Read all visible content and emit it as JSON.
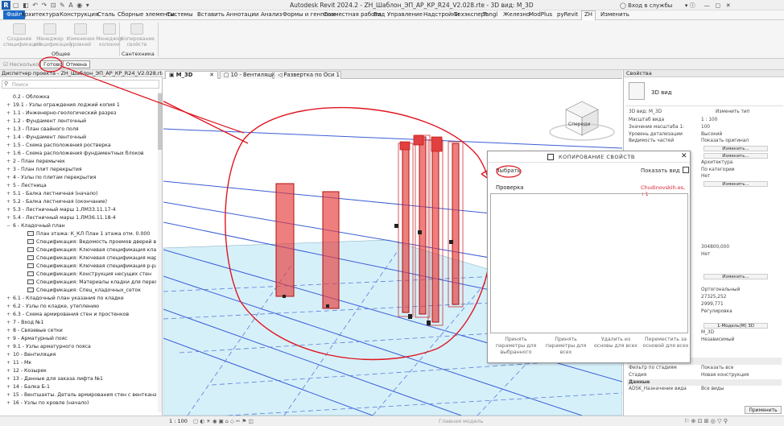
{
  "titlebar": {
    "logo": "R",
    "title": "Autodesk Revit 2024.2 - ZH_Шаблон_ЭП_АР_КР_R24_V2.028.rte - 3D вид: M_3D",
    "signin": "Вход в службы"
  },
  "menu": [
    "Файл",
    "Архитектура",
    "Конструкция",
    "Сталь",
    "Сборные элементы",
    "Системы",
    "Вставить",
    "Аннотации",
    "Анализ",
    "Формы и генплан",
    "Совместная работа",
    "Вид",
    "Управление",
    "Надстройки",
    "Техэксперт",
    "Tangl",
    "Железно",
    "ModPlus",
    "pyRevit",
    "ZH",
    "Изменить"
  ],
  "ribbon": {
    "buttons": [
      "Создание спецификаций",
      "Менеджер спецификаций",
      "Изменение уровней",
      "Менеджер колонок",
      "Копирование свойств"
    ],
    "groups": [
      "Общее",
      "Сантехника"
    ]
  },
  "options": {
    "checkbox": "Несколько",
    "done": "Готово",
    "cancel": "Отмена"
  },
  "browser": {
    "header": "Диспетчер проекта - ZH_Шаблон_ЭП_АР_КР_R24_V2.028.rte",
    "search_placeholder": "Поиск",
    "items": [
      {
        "exp": "",
        "label": "0.2 - Обложка",
        "indent": 1
      },
      {
        "exp": "+",
        "label": "19.1 - Узлы ограждения лоджий копия 1",
        "indent": 1
      },
      {
        "exp": "+",
        "label": "1.1 - Инженерно-геологический разрез",
        "indent": 1
      },
      {
        "exp": "+",
        "label": "1.2 - Фундамент ленточный",
        "indent": 1
      },
      {
        "exp": "+",
        "label": "1.3 - План свайного поля",
        "indent": 1
      },
      {
        "exp": "+",
        "label": "1.4 - Фундамент ленточный",
        "indent": 1
      },
      {
        "exp": "+",
        "label": "1.5 - Схема расположения ростверка",
        "indent": 1
      },
      {
        "exp": "+",
        "label": "1.6 - Схема расположения фундаментных блоков",
        "indent": 1
      },
      {
        "exp": "+",
        "label": "2 - План перемычек",
        "indent": 1
      },
      {
        "exp": "+",
        "label": "3 - План плит перекрытия",
        "indent": 1
      },
      {
        "exp": "+",
        "label": "4 - Узлы по плитам перекрытия",
        "indent": 1
      },
      {
        "exp": "+",
        "label": "5 - Лестница",
        "indent": 1
      },
      {
        "exp": "+",
        "label": "5.1 - Балка лестничная (начало)",
        "indent": 1
      },
      {
        "exp": "+",
        "label": "5.2 - Балка лестничная (окончание)",
        "indent": 1
      },
      {
        "exp": "+",
        "label": "5.3 - Лестничный марш 1.ЛМ33.11.17-4",
        "indent": 1
      },
      {
        "exp": "+",
        "label": "5.4 - Лестничный марш 1.ЛМ36.11.18-4",
        "indent": 1
      },
      {
        "exp": "−",
        "label": "6 - Кладочный план",
        "indent": 1
      },
      {
        "exp": "",
        "label": "План этажа: К_КЛ План 1 этажа отм. 0.000",
        "indent": 2,
        "sheet": true
      },
      {
        "exp": "",
        "label": "Спецификация: Ведомость проемов дверей выше 0",
        "indent": 2,
        "sheet": true
      },
      {
        "exp": "",
        "label": "Спецификация: Ключевая спецификация кладки",
        "indent": 2,
        "sheet": true
      },
      {
        "exp": "",
        "label": "Спецификация: Ключевая спецификация марки клади",
        "indent": 2,
        "sheet": true
      },
      {
        "exp": "",
        "label": "Спецификация: Ключевая спецификация р-ра",
        "indent": 2,
        "sheet": true
      },
      {
        "exp": "",
        "label": "Спецификация: Конструкция несущих стен",
        "indent": 2,
        "sheet": true
      },
      {
        "exp": "",
        "label": "Спецификация: Материалы кладки для перегородок",
        "indent": 2,
        "sheet": true
      },
      {
        "exp": "",
        "label": "Спецификация: Спец_кладочных_сеток",
        "indent": 2,
        "sheet": true
      },
      {
        "exp": "+",
        "label": "6.1 - Кладочный план указания по кладке",
        "indent": 1
      },
      {
        "exp": "+",
        "label": "6.2 - Узлы по кладке, утеплению",
        "indent": 1
      },
      {
        "exp": "+",
        "label": "6.3 - Схема армирования стен и простенков",
        "indent": 1
      },
      {
        "exp": "+",
        "label": "7 - Вход №1",
        "indent": 1
      },
      {
        "exp": "+",
        "label": "8 - Связевые сетки",
        "indent": 1
      },
      {
        "exp": "+",
        "label": "9 - Арматурный пояс",
        "indent": 1
      },
      {
        "exp": "+",
        "label": "9.1 - Узлы арматурного пояса",
        "indent": 1
      },
      {
        "exp": "+",
        "label": "10 - Вентиляция",
        "indent": 1
      },
      {
        "exp": "+",
        "label": "11 - Мк",
        "indent": 1
      },
      {
        "exp": "+",
        "label": "12 - Козырек",
        "indent": 1
      },
      {
        "exp": "+",
        "label": "13 - Данные для заказа лифта №1",
        "indent": 1
      },
      {
        "exp": "+",
        "label": "14 - Балка Б-1",
        "indent": 1
      },
      {
        "exp": "+",
        "label": "15 - Вентшахты. Деталь армирования стен с вентканалами.",
        "indent": 1
      },
      {
        "exp": "+",
        "label": "16 - Узлы по кровле (начало)",
        "indent": 1
      }
    ]
  },
  "tabs": [
    {
      "label": "M_3D",
      "active": true
    },
    {
      "label": "10 - Вентиляция",
      "active": false
    },
    {
      "label": "Развертка по Оси 1",
      "active": false
    }
  ],
  "viewcube": {
    "label": "Спереди"
  },
  "dialog": {
    "title": "КОПИРОВАНИЕ СВОЙСТВ",
    "close": "✕",
    "pick": "Выбрать",
    "show_view": "Показать вид",
    "check": "Проверка",
    "user": "Chudinovskih.es, +1",
    "actions": [
      "Принять параметры для выбранного",
      "Принять параметры для всех",
      "Удалить из основы для всех",
      "Переместить за основой для всех"
    ]
  },
  "properties": {
    "header": "Свойства",
    "type_name": "3D вид",
    "selector": "3D вид: M_3D",
    "edit_type": "Изменить тип",
    "rows": [
      {
        "k": "Масштаб вида",
        "v": "1 : 100"
      },
      {
        "k": "Значение масштаба  1:",
        "v": "100"
      },
      {
        "k": "Уровень детализации",
        "v": "Высокий"
      },
      {
        "k": "Видимость частей",
        "v": "Показать оригинал"
      },
      {
        "k": "",
        "v": "",
        "edit": "Изменить..."
      },
      {
        "k": "",
        "v": "",
        "edit": "Изменить..."
      },
      {
        "k": "",
        "v": "Архитектура"
      },
      {
        "k": "",
        "v": "По категории"
      },
      {
        "k": "",
        "v": "Нет"
      },
      {
        "k": "",
        "v": "",
        "edit": "Изменить..."
      },
      {
        "k": "",
        "v": ""
      },
      {
        "k": "",
        "v": ""
      },
      {
        "k": "",
        "v": ""
      },
      {
        "k": "",
        "v": ""
      },
      {
        "k": "",
        "v": ""
      },
      {
        "k": "",
        "v": ""
      },
      {
        "k": "",
        "v": ""
      },
      {
        "k": "",
        "v": ""
      },
      {
        "k": "",
        "v": "304800,000"
      },
      {
        "k": "",
        "v": "Нет"
      },
      {
        "k": "",
        "v": ""
      },
      {
        "k": "",
        "v": ""
      },
      {
        "k": "",
        "v": "",
        "edit": "Изменить..."
      },
      {
        "k": "",
        "v": ""
      },
      {
        "k": "",
        "v": "Ортогональный"
      },
      {
        "k": "",
        "v": "27325,252"
      },
      {
        "k": "",
        "v": "2999,771"
      },
      {
        "k": "",
        "v": "Регулировка"
      },
      {
        "k": "",
        "v": ""
      },
      {
        "k": "",
        "v": "",
        "edit": "1-Модель(М) 3D"
      },
      {
        "k": "",
        "v": "M_3D"
      },
      {
        "k": "",
        "v": "Независимый"
      },
      {
        "k": "",
        "v": ""
      },
      {
        "k": "ADSK_Владелец вида",
        "v": ""
      },
      {
        "k": "Стадии",
        "v": "",
        "sec": true
      },
      {
        "k": "Фильтр по стадиям",
        "v": "Показать все"
      },
      {
        "k": "Стадия",
        "v": "Новая конструкция"
      },
      {
        "k": "Данные",
        "v": "",
        "sec": true
      },
      {
        "k": "ADSK_Назначение вида",
        "v": "Все виды"
      }
    ],
    "apply": "Применить"
  },
  "status": {
    "scale": "1 : 100",
    "model": "Главная модель"
  },
  "colors": {
    "accent": "#1b6ac9",
    "annotation": "#e0141e",
    "floor": "#d6f0fa"
  }
}
